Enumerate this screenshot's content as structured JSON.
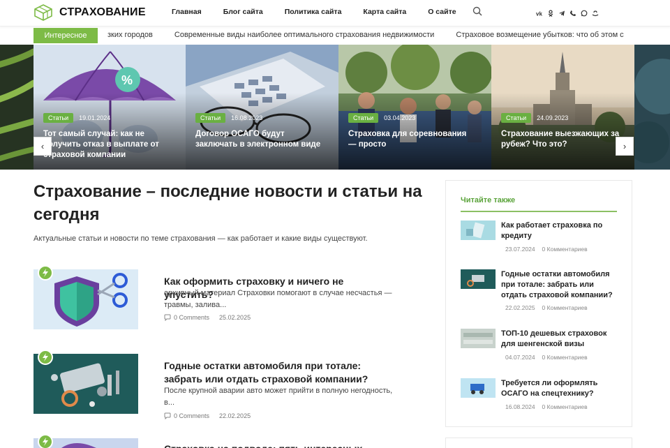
{
  "header": {
    "logo_text": "СТРАХОВАНИЕ",
    "nav": [
      "Главная",
      "Блог сайта",
      "Политика сайта",
      "Карта сайта",
      "О сайте"
    ],
    "socials": [
      "vk-icon",
      "ok-icon",
      "telegram-icon",
      "viber-icon",
      "whatsapp-icon",
      "odnoklassniki-icon"
    ]
  },
  "ticker": {
    "badge": "Интересное",
    "items": [
      "зких городов",
      "Современные виды наиболее оптимального страхования недвижимости",
      "Страховое возмещение убытков: что об этом с"
    ]
  },
  "slider": {
    "slides": [
      {
        "category": "Статьи",
        "date": "19.01.2024",
        "title": "Тот самый случай: как не получить отказ в выплате от страховой компании"
      },
      {
        "category": "Статьи",
        "date": "16.08.2023",
        "title": "Договор ОСАГО будут заключать в электронном виде"
      },
      {
        "category": "Статьи",
        "date": "03.04.2023",
        "title": "Страховка для соревнования — просто"
      },
      {
        "category": "Статьи",
        "date": "24.09.2023",
        "title": "Страхование выезжающих за рубеж? Что это?"
      }
    ],
    "prev": "‹",
    "next": "›"
  },
  "main": {
    "title": "Страхование – последние новости и статьи на сегодня",
    "description": "Актуальные статьи и новости по теме страхования — как работает и какие виды существуют.",
    "articles": [
      {
        "title": "Как оформить страховку и ничего не упустить?",
        "excerpt": "архивный материал Страховки помогают в случае несчастья — травмы, залива...",
        "comments": "0 Comments",
        "date": "25.02.2025"
      },
      {
        "title": "Годные остатки автомобиля при тотале: забрать или отдать страховой компании?",
        "excerpt": "После крупной аварии авто может прийти в полную негодность, в...",
        "comments": "0 Comments",
        "date": "22.02.2025"
      },
      {
        "title": "Страховка на подводе: пять интересных",
        "excerpt": "",
        "comments": "",
        "date": ""
      }
    ]
  },
  "sidebar": {
    "title": "Читайте также",
    "items": [
      {
        "title": "Как работает страховка по кредиту",
        "date": "23.07.2024",
        "comments": "0 Комментариев"
      },
      {
        "title": "Годные остатки автомобиля при тотале: забрать или отдать страховой компании?",
        "date": "22.02.2025",
        "comments": "0 Комментариев"
      },
      {
        "title": "ТОП-10 дешевых страховок для шенгенской визы",
        "date": "04.07.2024",
        "comments": "0 Комментариев"
      },
      {
        "title": "Требуется ли оформлять ОСАГО на спецтехнику?",
        "date": "16.08.2024",
        "comments": "0 Комментариев"
      }
    ]
  },
  "colors": {
    "accent": "#7dbb46",
    "accent_dark": "#5aa33a"
  }
}
